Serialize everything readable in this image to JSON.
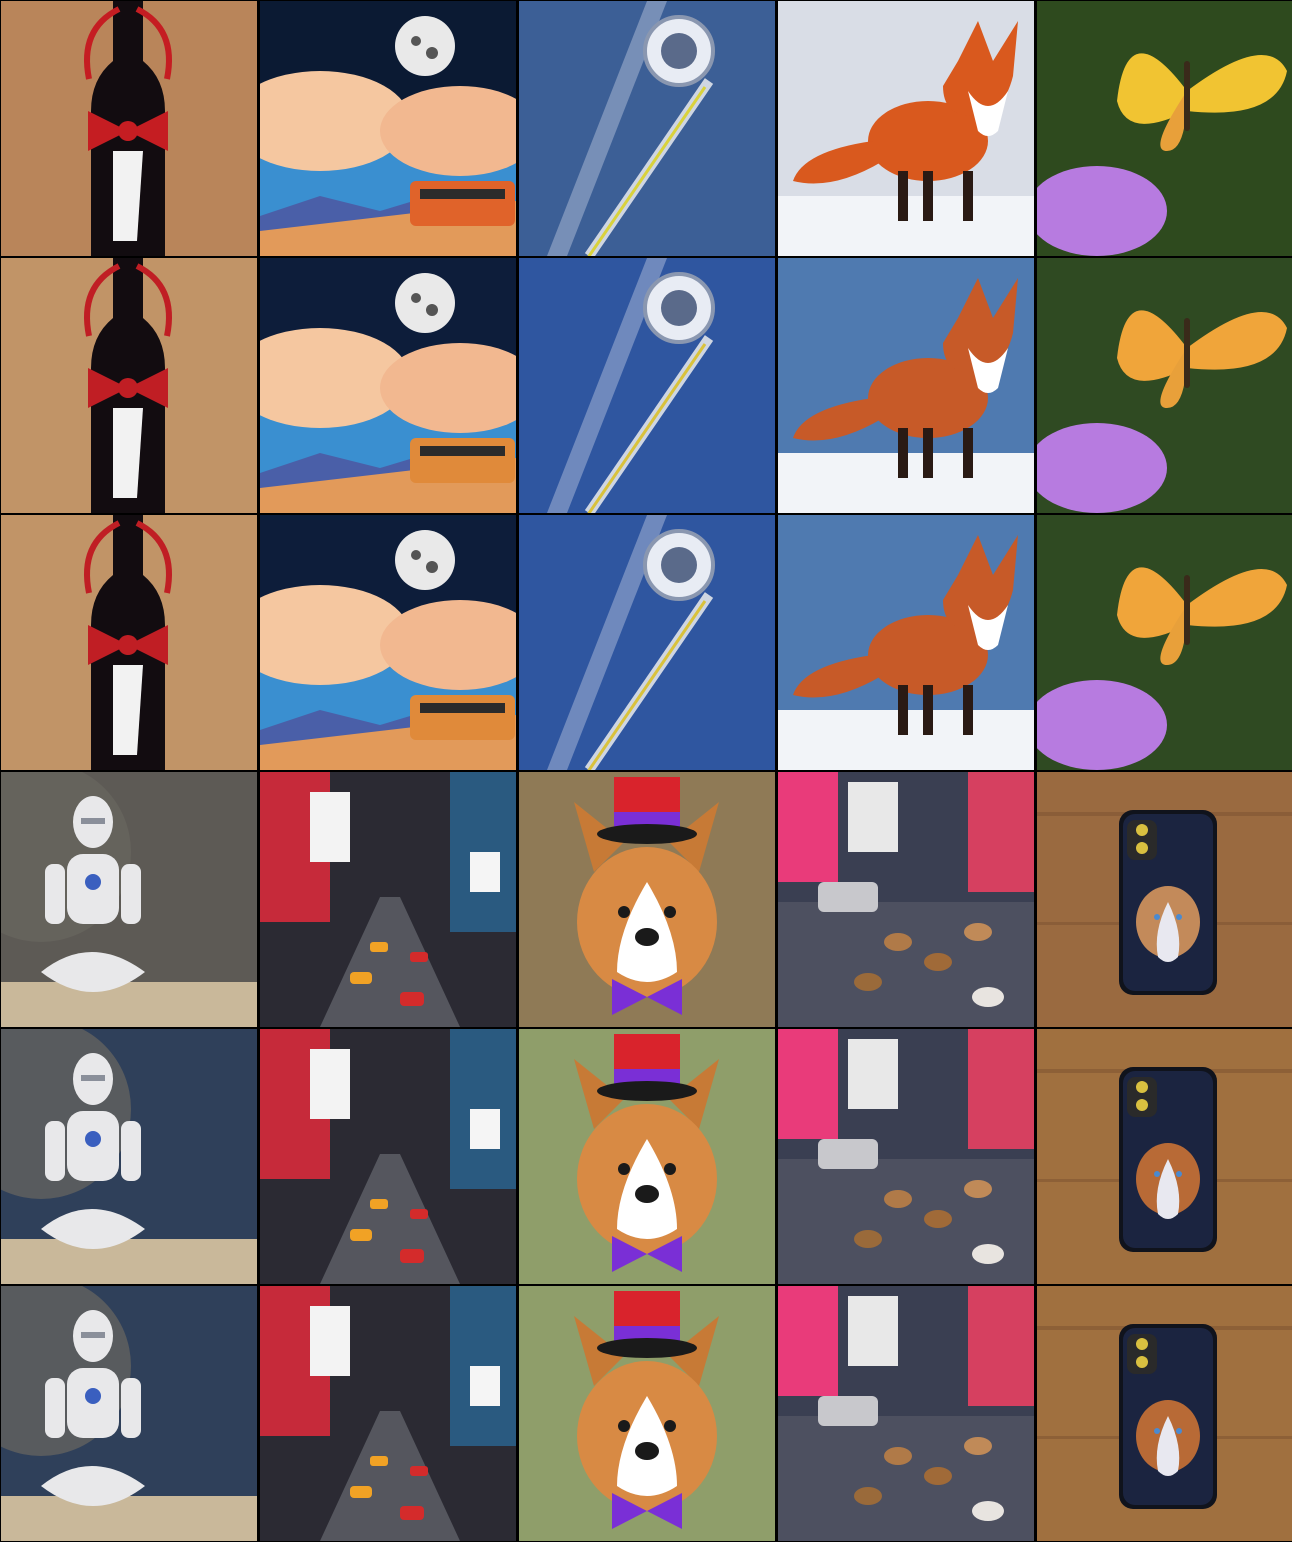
{
  "grid": {
    "columns": 5,
    "rows": 6,
    "tiles": [
      {
        "subject": "wine-bottle-with-red-bow",
        "icon": "wine-bottle-icon",
        "bg": "#b9855a",
        "accent": "#c51d22"
      },
      {
        "subject": "train-under-moon-and-clouds",
        "icon": "train-icon",
        "bg": "#0b1a33",
        "accent": "#e0632a"
      },
      {
        "subject": "space-station-tower",
        "icon": "space-station-icon",
        "bg": "#3c5f96",
        "accent": "#d9d23c"
      },
      {
        "subject": "red-fox-in-snow",
        "icon": "fox-icon",
        "bg": "#d9dde6",
        "accent": "#d9591e"
      },
      {
        "subject": "butterfly-on-purple-flower",
        "icon": "butterfly-icon",
        "bg": "#2e4a1e",
        "accent": "#f1c432"
      },
      {
        "subject": "wine-bottle-with-red-bow",
        "icon": "wine-bottle-icon",
        "bg": "#c19467",
        "accent": "#c01e24"
      },
      {
        "subject": "train-under-moon-and-clouds",
        "icon": "train-icon",
        "bg": "#0d1d3a",
        "accent": "#e08a3a"
      },
      {
        "subject": "space-station-tower",
        "icon": "space-station-icon",
        "bg": "#2f56a0",
        "accent": "#d9c23c"
      },
      {
        "subject": "red-fox-in-snow",
        "icon": "fox-icon",
        "bg": "#4f7ab0",
        "accent": "#c75a28"
      },
      {
        "subject": "butterfly-on-purple-flower",
        "icon": "butterfly-icon",
        "bg": "#2f4a22",
        "accent": "#f0a53a"
      },
      {
        "subject": "wine-bottle-with-red-bow",
        "icon": "wine-bottle-icon",
        "bg": "#c19467",
        "accent": "#c01e24"
      },
      {
        "subject": "train-under-moon-and-clouds",
        "icon": "train-icon",
        "bg": "#0d1d3a",
        "accent": "#e08a3a"
      },
      {
        "subject": "space-station-tower",
        "icon": "space-station-icon",
        "bg": "#2f56a0",
        "accent": "#d9c23c"
      },
      {
        "subject": "red-fox-in-snow",
        "icon": "fox-icon",
        "bg": "#4f7ab0",
        "accent": "#c75a28"
      },
      {
        "subject": "butterfly-on-purple-flower",
        "icon": "butterfly-icon",
        "bg": "#2f4a22",
        "accent": "#f0a53a"
      },
      {
        "subject": "robot-sitting-on-rock",
        "icon": "robot-icon",
        "bg": "#5d5a55",
        "accent": "#e8e8ea"
      },
      {
        "subject": "city-street-with-billboards",
        "icon": "city-street-icon",
        "bg": "#2b2a33",
        "accent": "#f1a225"
      },
      {
        "subject": "corgi-with-top-hat-and-bow-tie",
        "icon": "corgi-icon",
        "bg": "#8f7a56",
        "accent": "#7a2fd6"
      },
      {
        "subject": "crowd-of-dogs-in-city-street",
        "icon": "dogs-crowd-icon",
        "bg": "#3a3f52",
        "accent": "#e93b7a"
      },
      {
        "subject": "phone-case-with-dog-portrait",
        "icon": "phone-case-icon",
        "bg": "#9a6a40",
        "accent": "#c38a5a"
      },
      {
        "subject": "robot-sitting-in-forest",
        "icon": "robot-icon",
        "bg": "#2f405a",
        "accent": "#e8e8ea"
      },
      {
        "subject": "city-street-with-billboards",
        "icon": "city-street-icon",
        "bg": "#2b2a33",
        "accent": "#f1a225"
      },
      {
        "subject": "corgi-with-top-hat-and-bow-tie",
        "icon": "corgi-icon",
        "bg": "#8f9e6a",
        "accent": "#7a2fd6"
      },
      {
        "subject": "crowd-of-dogs-in-city-street",
        "icon": "dogs-crowd-icon",
        "bg": "#3a3f52",
        "accent": "#e93b7a"
      },
      {
        "subject": "phone-case-with-dog-portrait",
        "icon": "phone-case-icon",
        "bg": "#a0703f",
        "accent": "#b86a36"
      },
      {
        "subject": "robot-sitting-in-forest",
        "icon": "robot-icon",
        "bg": "#2f405a",
        "accent": "#e8e8ea"
      },
      {
        "subject": "city-street-with-billboards",
        "icon": "city-street-icon",
        "bg": "#2b2a33",
        "accent": "#f1a225"
      },
      {
        "subject": "corgi-with-top-hat-and-bow-tie",
        "icon": "corgi-icon",
        "bg": "#8f9e6a",
        "accent": "#7a2fd6"
      },
      {
        "subject": "crowd-of-dogs-in-city-street",
        "icon": "dogs-crowd-icon",
        "bg": "#3a3f52",
        "accent": "#e93b7a"
      },
      {
        "subject": "phone-case-with-dog-portrait",
        "icon": "phone-case-icon",
        "bg": "#a0703f",
        "accent": "#b86a36"
      }
    ]
  }
}
